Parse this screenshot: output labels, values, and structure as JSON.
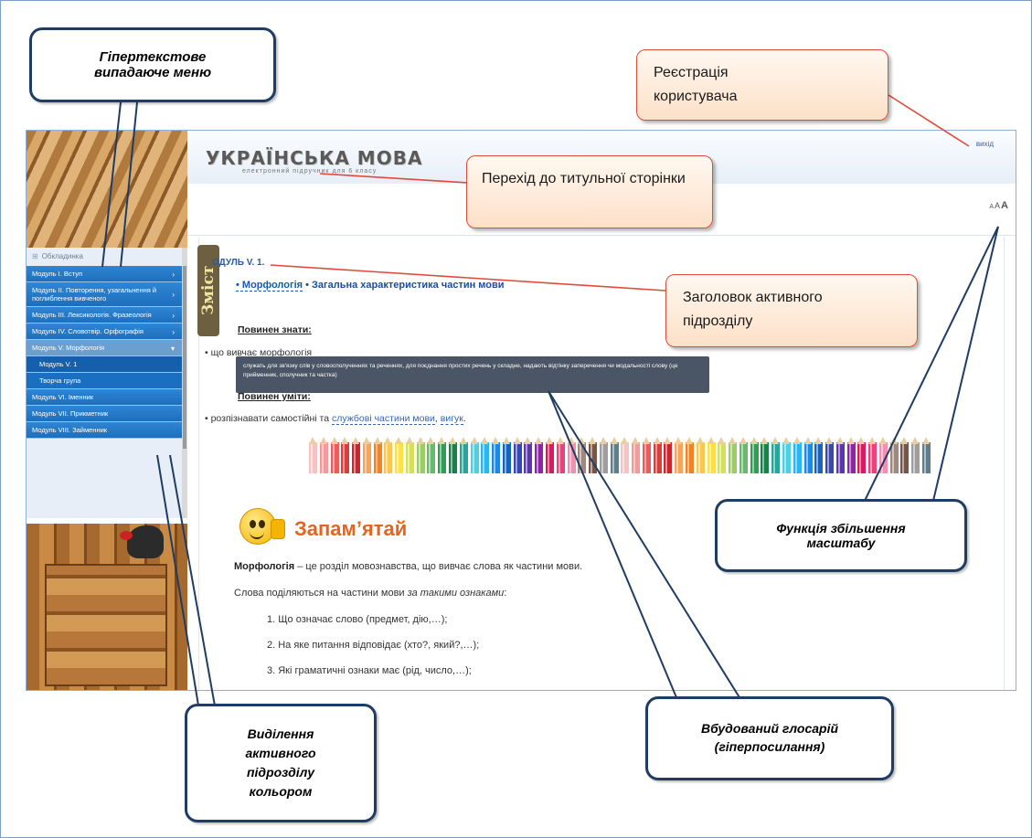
{
  "callouts": {
    "hypertext_menu": "Гіпертекстове випадаюче меню",
    "user_registration": "Реєстрація користувача",
    "title_page_link": "Перехід до титульної сторінки",
    "active_heading": "Заголовок активного підрозділу",
    "zoom_function": "Функція збільшення масштабу",
    "color_highlight": "Виділення активного підрозділу кольором",
    "glossary": "Вбудований глосарій (гіперпосилання)"
  },
  "site": {
    "logo": "УКРАЇНСЬКА МОВА",
    "logo_sub": "електронний підручник для 6 класу",
    "login": "вихід",
    "font_sizes": [
      "A",
      "A",
      "A"
    ]
  },
  "sidebar": {
    "cover": "Обкладинка",
    "items": [
      {
        "label": "Модуль I. Вступ",
        "arrow": "›"
      },
      {
        "label": "Модуль II. Повторення, узагальнення й поглиблення вивченого",
        "arrow": "›"
      },
      {
        "label": "Модуль III. Лексикологія. Фразеологія",
        "arrow": "›"
      },
      {
        "label": "Модуль IV. Словотвір. Орфографія",
        "arrow": "›"
      },
      {
        "label": "Модуль V. Морфологія",
        "arrow": "▾"
      },
      {
        "label": "Модуль V. 1"
      },
      {
        "label": "Творча група"
      },
      {
        "label": "Модуль VI. Іменник"
      },
      {
        "label": "Модуль VII. Прикметник"
      },
      {
        "label": "Модуль VIII. Займенник"
      }
    ]
  },
  "content": {
    "zmist": "Зміст",
    "module_title": "ОДУЛЬ V. 1.",
    "crumb_1": "• Морфологія",
    "crumb_2": "• Загальна характеристика частин мови",
    "must_know": "Повинен знати:",
    "know_text": "• що вивчає морфологія",
    "tooltip": "служать для зв'язку слів у словосполученнях та реченнях, для поєднання простих речень у складне, надають відтінку заперечення чи модальності слову (це прийменник, сполучник та частка)",
    "must_able": "Повинен уміти:",
    "able_pre": "• розпізнавати самостійні та ",
    "able_link": "службові частини мови",
    "able_mid": ", ",
    "able_link2": "вигук",
    "able_end": ".",
    "remember": "Запам’ятай",
    "def_bold": "Морфологія",
    "def_rest": " – це розділ мовознавства, що вивчає слова як  частини мови.",
    "split_pre": "Слова поділяються на частини мови ",
    "split_ital": "за такими ознаками",
    "split_end": ":",
    "list": [
      "1. Що означає слово (предмет, дію,…);",
      "2. На яке питання відповідає (хто?, який?,…);",
      "3. Які граматичні ознаки має (рід, число,…);"
    ]
  },
  "pencil_colors": [
    "#f4c4c4",
    "#f49a9a",
    "#ef5b5b",
    "#e23a3a",
    "#c9262e",
    "#f7a35c",
    "#f58220",
    "#f9c74f",
    "#fde047",
    "#d4e157",
    "#9ccc65",
    "#66bb6a",
    "#2e9e55",
    "#1b7f4a",
    "#26a69a",
    "#4dd0e1",
    "#29b6f6",
    "#1e88e5",
    "#1565c0",
    "#3949ab",
    "#5e35b1",
    "#8e24aa",
    "#d81b60",
    "#ec407a",
    "#f48fb1",
    "#a1887f",
    "#795548",
    "#9e9e9e",
    "#607d8b",
    "#f4c4c4",
    "#f49a9a",
    "#ef5b5b",
    "#e23a3a",
    "#c9262e",
    "#f7a35c",
    "#f58220",
    "#f9c74f",
    "#fde047",
    "#d4e157",
    "#9ccc65",
    "#66bb6a",
    "#2e9e55",
    "#1b7f4a",
    "#26a69a",
    "#4dd0e1",
    "#29b6f6",
    "#1e88e5",
    "#1565c0",
    "#3949ab",
    "#5e35b1",
    "#8e24aa",
    "#d81b60",
    "#ec407a",
    "#f48fb1",
    "#a1887f",
    "#795548",
    "#9e9e9e",
    "#607d8b"
  ]
}
